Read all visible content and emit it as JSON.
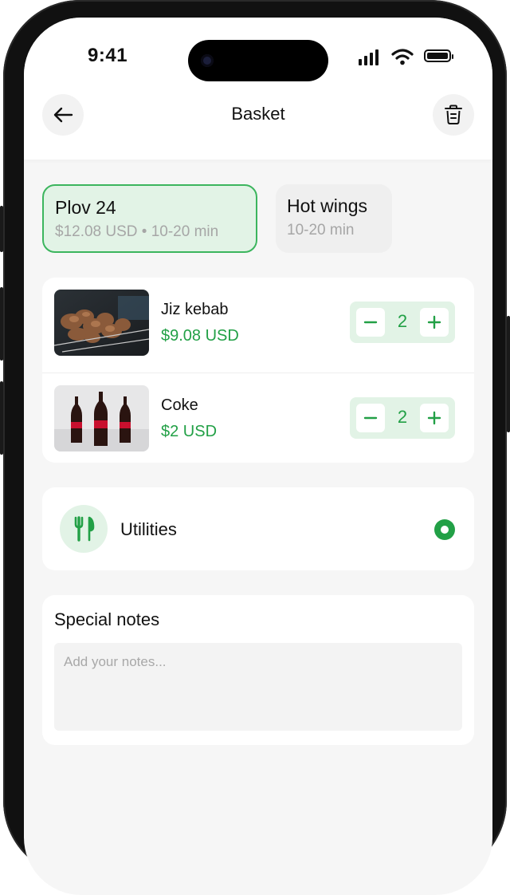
{
  "status_bar": {
    "time": "9:41"
  },
  "header": {
    "title": "Basket",
    "back_icon": "arrow-left-icon",
    "trash_icon": "trash-icon"
  },
  "restaurants": [
    {
      "name": "Plov 24",
      "meta": "$12.08 USD • 10-20 min",
      "selected": true
    },
    {
      "name": "Hot wings",
      "meta": "10-20 min",
      "selected": false
    }
  ],
  "basket_items": [
    {
      "name": "Jiz kebab",
      "price": "$9.08 USD",
      "quantity": "2",
      "image": "kebab-photo"
    },
    {
      "name": "Coke",
      "price": "$2 USD",
      "quantity": "2",
      "image": "coke-bottles-photo"
    }
  ],
  "utilities": {
    "label": "Utilities",
    "icon": "fork-knife-icon",
    "selected": true
  },
  "notes": {
    "title": "Special notes",
    "placeholder": "Add your notes..."
  },
  "colors": {
    "accent": "#22a046",
    "accent_light": "#e2f3e6",
    "selected_border": "#3cb55e",
    "muted_text": "#a6a6a6"
  }
}
